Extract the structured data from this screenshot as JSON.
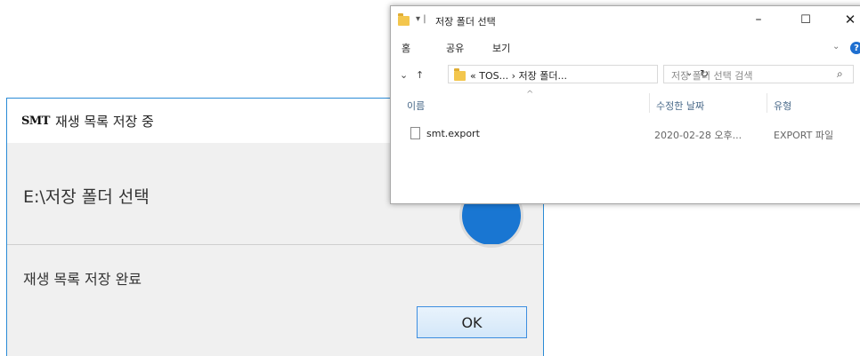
{
  "dialog": {
    "logo": "SMT",
    "title": "재생 목록 저장 중",
    "path": "E:\\저장 폴더 선택",
    "message": "재생 목록 저장 완료",
    "ok_label": "OK",
    "accent_color": "#2a8bd6"
  },
  "explorer": {
    "quick_access": "▾ |",
    "title": "저장 폴더 선택",
    "window_buttons": {
      "minimize": "–",
      "maximize": "☐",
      "close": "✕"
    },
    "ribbon_tabs": [
      "홈",
      "공유",
      "보기"
    ],
    "help": "?",
    "address": "« TOS... › 저장 폴더...",
    "search_placeholder": "저장 폴더 선택 검색",
    "columns": {
      "name": "이름",
      "modified": "수정한 날짜",
      "type": "유형"
    },
    "files": [
      {
        "name": "smt.export",
        "modified": "2020-02-28 오후...",
        "type": "EXPORT 파일"
      }
    ]
  }
}
